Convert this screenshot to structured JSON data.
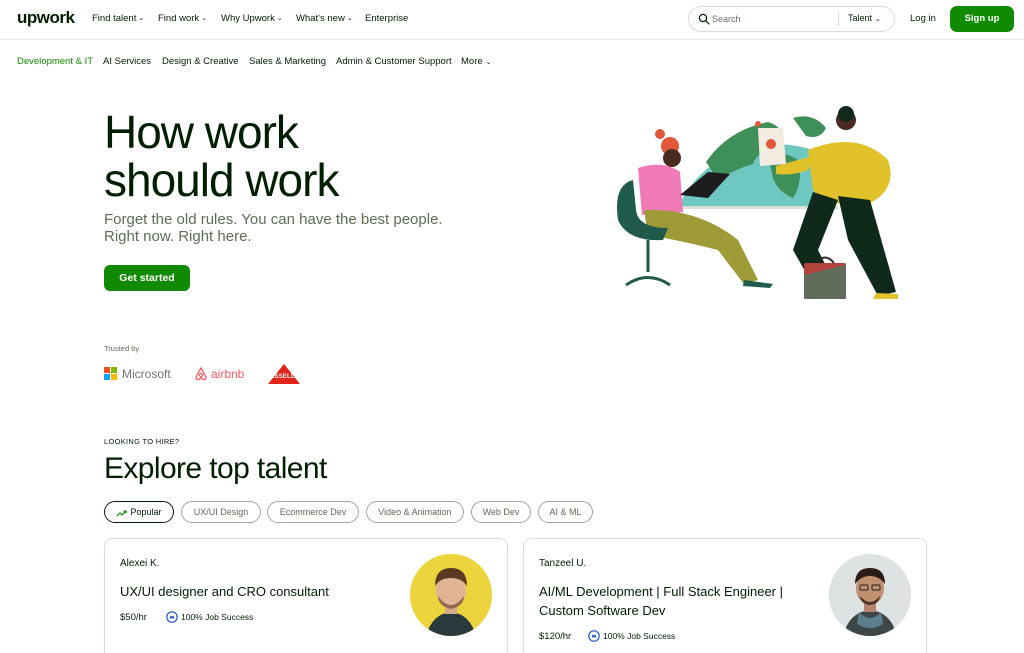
{
  "header": {
    "logo": "upwork",
    "nav": [
      {
        "label": "Find talent",
        "chevron": true
      },
      {
        "label": "Find work",
        "chevron": true
      },
      {
        "label": "Why Upwork",
        "chevron": true
      },
      {
        "label": "What's new",
        "chevron": true
      },
      {
        "label": "Enterprise",
        "chevron": false
      }
    ],
    "search": {
      "placeholder": "Search",
      "scope": "Talent"
    },
    "login": "Log in",
    "signup": "Sign up"
  },
  "categories": {
    "items": [
      "Development & IT",
      "AI Services",
      "Design & Creative",
      "Sales & Marketing",
      "Admin & Customer Support",
      "More"
    ],
    "active": "Development & IT"
  },
  "hero": {
    "title_line1": "How work",
    "title_line2": "should work",
    "subtitle_line1": "Forget the old rules. You can have the best people.",
    "subtitle_line2": "Right now. Right here.",
    "cta": "Get started"
  },
  "trusted": {
    "label": "Trusted by",
    "brands": [
      "Microsoft",
      "airbnb",
      "BISSELL"
    ]
  },
  "explore": {
    "eyebrow": "LOOKING TO HIRE?",
    "title": "Explore top talent",
    "chips": [
      "Popular",
      "UX/UI Design",
      "Ecommerce Dev",
      "Video & Animation",
      "Web Dev",
      "AI & ML"
    ],
    "active_chip": "Popular",
    "cards": [
      {
        "name": "Alexei K.",
        "role": "UX/UI designer and CRO consultant",
        "rate": "$50/hr",
        "job_success": "100% Job Success"
      },
      {
        "name": "Tanzeel U.",
        "role": "AI/ML Development | Full Stack Engineer | Custom Software Dev",
        "rate": "$120/hr",
        "job_success": "100% Job Success"
      }
    ]
  },
  "colors": {
    "brand_green": "#108a00",
    "ink": "#001e00",
    "muted": "#5e6d55",
    "border": "#d5e0d5"
  },
  "icons": [
    "search-icon",
    "chevron-down-icon",
    "trending-up-icon",
    "job-success-badge-icon"
  ]
}
